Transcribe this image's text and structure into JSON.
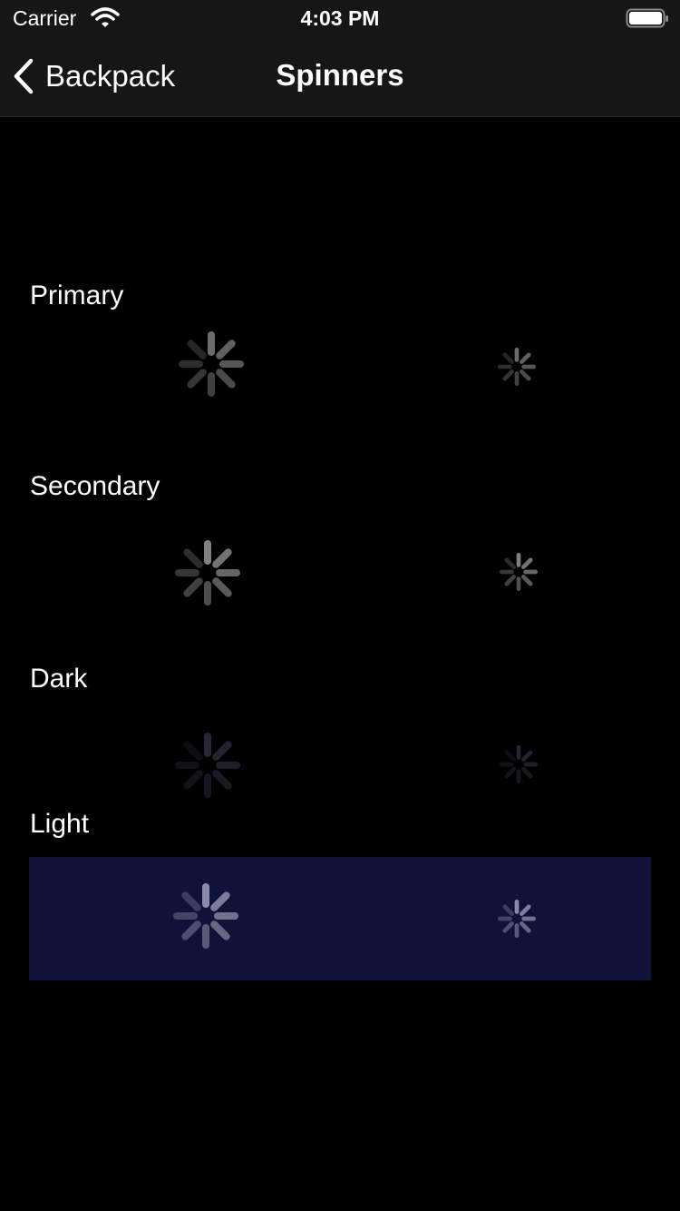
{
  "status_bar": {
    "carrier": "Carrier",
    "time": "4:03 PM",
    "icons": [
      "wifi-icon",
      "battery-icon"
    ]
  },
  "nav": {
    "back_label": "Backpack",
    "title": "Spinners"
  },
  "sections": [
    {
      "label": "Primary",
      "color": "#6b6b6b"
    },
    {
      "label": "Secondary",
      "color": "#808080"
    },
    {
      "label": "Dark",
      "color": "#262636"
    },
    {
      "label": "Light",
      "color": "#8a8aa6",
      "background": "#11123a"
    }
  ],
  "colors": {
    "background": "#000000",
    "bar": "#161616",
    "light_panel": "#11123a"
  }
}
